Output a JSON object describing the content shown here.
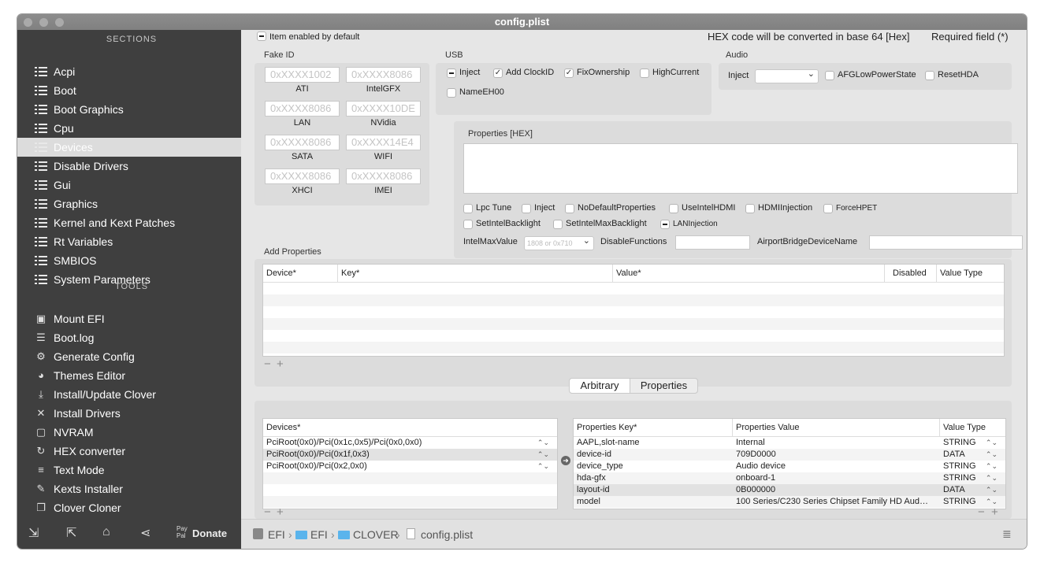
{
  "window": {
    "title": "config.plist"
  },
  "sidebar": {
    "sections_header": "SECTIONS",
    "tools_header": "TOOLS",
    "sections": [
      "Acpi",
      "Boot",
      "Boot Graphics",
      "Cpu",
      "Devices",
      "Disable Drivers",
      "Gui",
      "Graphics",
      "Kernel and Kext Patches",
      "Rt Variables",
      "SMBIOS",
      "System Parameters"
    ],
    "selected": "Devices",
    "tools": [
      {
        "label": "Mount EFI",
        "icon": "disk-icon"
      },
      {
        "label": "Boot.log",
        "icon": "log-icon"
      },
      {
        "label": "Generate Config",
        "icon": "gears-icon"
      },
      {
        "label": "Themes Editor",
        "icon": "palette-icon"
      },
      {
        "label": "Install/Update Clover",
        "icon": "download-icon"
      },
      {
        "label": "Install Drivers",
        "icon": "tools-icon"
      },
      {
        "label": "NVRAM",
        "icon": "chip-icon"
      },
      {
        "label": "HEX converter",
        "icon": "refresh-icon"
      },
      {
        "label": "Text Mode",
        "icon": "text-icon"
      },
      {
        "label": "Kexts Installer",
        "icon": "puzzle-icon"
      },
      {
        "label": "Clover Cloner",
        "icon": "copy-icon"
      }
    ],
    "bottom": {
      "donate_prefix": "Pay Pal",
      "donate": "Donate"
    }
  },
  "top": {
    "item_enabled": "Item enabled by default",
    "hex_note": "HEX code will be converted in base 64 [Hex]",
    "required": "Required field (*)"
  },
  "fakeid": {
    "title": "Fake ID",
    "fields": [
      {
        "placeholder": "0xXXXX1002",
        "label": "ATI"
      },
      {
        "placeholder": "0xXXXX8086",
        "label": "IntelGFX"
      },
      {
        "placeholder": "0xXXXX8086",
        "label": "LAN"
      },
      {
        "placeholder": "0xXXXX10DE",
        "label": "NVidia"
      },
      {
        "placeholder": "0xXXXX8086",
        "label": "SATA"
      },
      {
        "placeholder": "0xXXXX14E4",
        "label": "WIFI"
      },
      {
        "placeholder": "0xXXXX8086",
        "label": "XHCI"
      },
      {
        "placeholder": "0xXXXX8086",
        "label": "IMEI"
      }
    ]
  },
  "usb": {
    "title": "USB",
    "inject": "Inject",
    "add_clockid": "Add ClockID",
    "fixownership": "FixOwnership",
    "highcurrent": "HighCurrent",
    "nameeh00": "NameEH00"
  },
  "audio": {
    "title": "Audio",
    "inject": "Inject",
    "afg": "AFGLowPowerState",
    "resethda": "ResetHDA"
  },
  "properties_hex": {
    "title": "Properties [HEX]"
  },
  "options": {
    "lpc_tune": "Lpc Tune",
    "inject": "Inject",
    "nodefault": "NoDefaultProperties",
    "useintelhdmi": "UseIntelHDMI",
    "hdmiinjection": "HDMIInjection",
    "forcehpet": "ForceHPET",
    "setintelbacklight": "SetIntelBacklight",
    "setintelmaxbacklight": "SetIntelMaxBacklight",
    "laninjection": "LANInjection",
    "intelmaxvalue": "IntelMaxValue",
    "intelmax_placeholder": "1808 or 0x710",
    "disablefunctions": "DisableFunctions",
    "airport": "AirportBridgeDeviceName"
  },
  "add_properties": {
    "title": "Add Properties",
    "columns": [
      "Device*",
      "Key*",
      "Value*",
      "Disabled",
      "Value Type"
    ]
  },
  "tabs": {
    "arbitrary": "Arbitrary",
    "properties": "Properties"
  },
  "devices_table": {
    "header": "Devices*",
    "rows": [
      "PciRoot(0x0)/Pci(0x1c,0x5)/Pci(0x0,0x0)",
      "PciRoot(0x0)/Pci(0x1f,0x3)",
      "PciRoot(0x0)/Pci(0x2,0x0)"
    ]
  },
  "props_table": {
    "columns": [
      "Properties Key*",
      "Properties Value",
      "Value Type"
    ],
    "rows": [
      {
        "key": "AAPL,slot-name",
        "value": "Internal",
        "type": "STRING"
      },
      {
        "key": "device-id",
        "value": "709D0000",
        "type": "DATA"
      },
      {
        "key": "device_type",
        "value": "Audio device",
        "type": "STRING"
      },
      {
        "key": "hda-gfx",
        "value": "onboard-1",
        "type": "STRING"
      },
      {
        "key": "layout-id",
        "value": "0B000000",
        "type": "DATA"
      },
      {
        "key": "model",
        "value": "100 Series/C230 Series Chipset Family HD Aud…",
        "type": "STRING"
      }
    ]
  },
  "breadcrumb": [
    "EFI",
    "EFI",
    "CLOVER",
    "config.plist"
  ]
}
